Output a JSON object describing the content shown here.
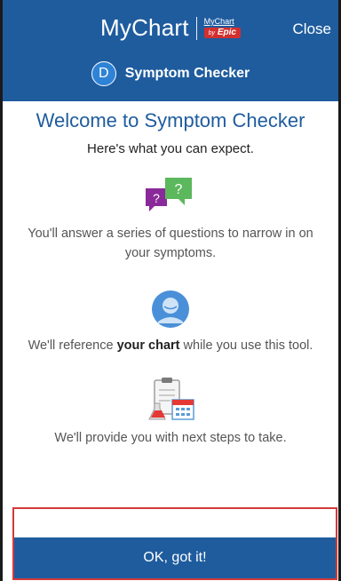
{
  "header": {
    "brand_text": "MyChart",
    "logo_small_text": "MyChart",
    "logo_by_text": "by",
    "logo_epic_text": "Epic",
    "close_label": "Close",
    "avatar_letter": "D",
    "subtitle": "Symptom Checker",
    "background_color": "#1f5c9e"
  },
  "main": {
    "title": "Welcome to Symptom Checker",
    "subtitle": "Here's what you can expect.",
    "items": [
      {
        "icon": "question-bubbles-icon",
        "text": "You'll answer a series of questions to narrow in on your symptoms."
      },
      {
        "icon": "person-avatar-icon",
        "text_before": "We'll reference ",
        "text_bold": "your chart",
        "text_after": " while you use this tool."
      },
      {
        "icon": "clipboard-calendar-icon",
        "text": "We'll provide you with next steps to take."
      }
    ]
  },
  "footer": {
    "ok_label": "OK, got it!"
  }
}
